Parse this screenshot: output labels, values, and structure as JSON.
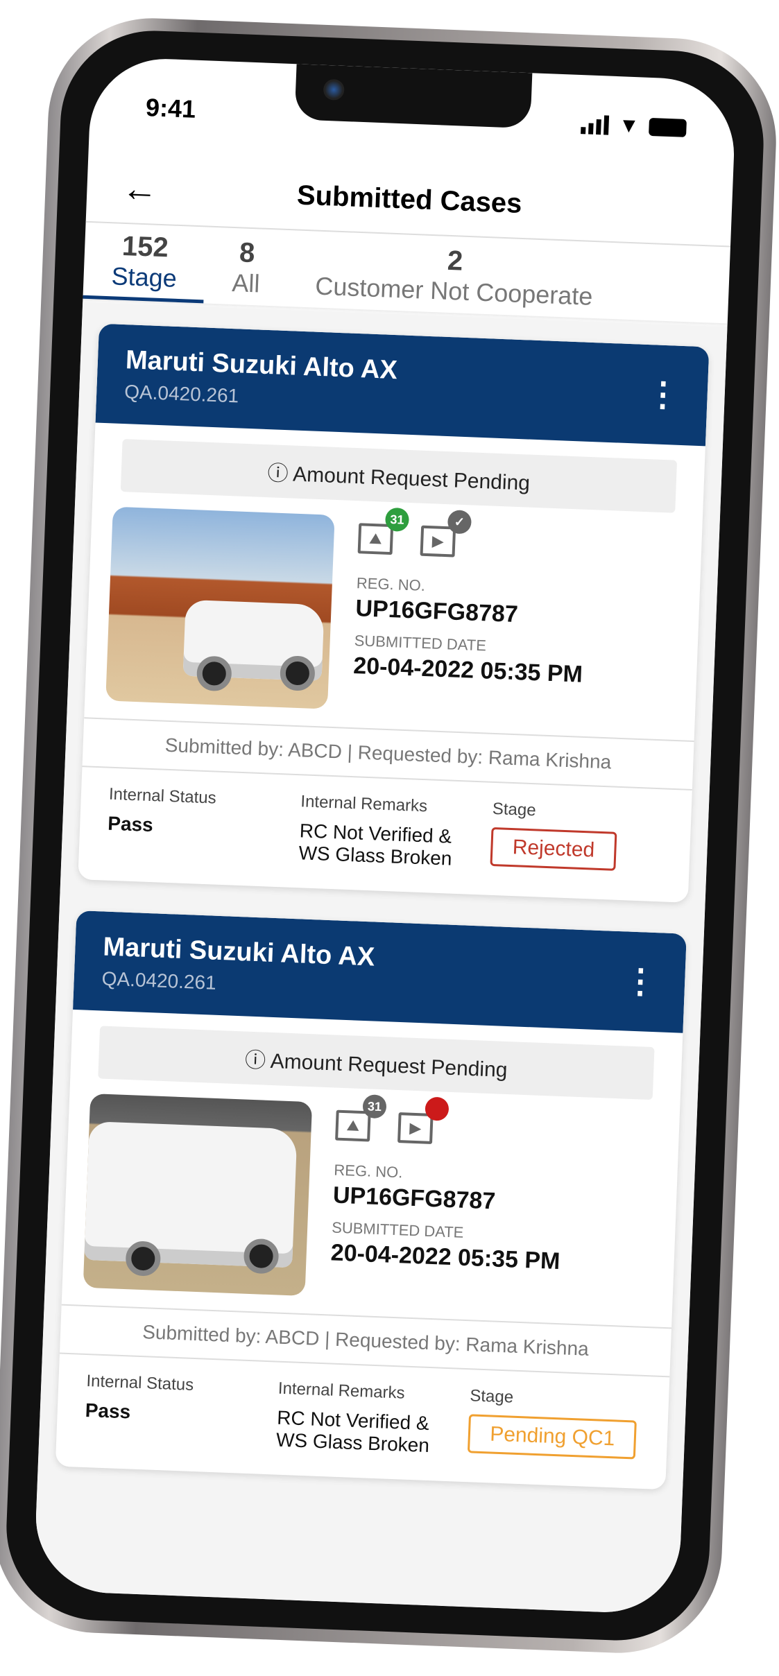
{
  "status_bar": {
    "time": "9:41"
  },
  "header": {
    "title": "Submitted Cases",
    "back_icon": "arrow-left-icon"
  },
  "tabs": [
    {
      "count": "152",
      "label": "Stage",
      "active": true
    },
    {
      "count": "8",
      "label": "All"
    },
    {
      "count": "2",
      "label": "Customer Not Cooperate"
    }
  ],
  "colors": {
    "brand": "#0b3a72",
    "rejected": "#c0392b",
    "pending_qc": "#f0a030",
    "photo_badge_green": "#2e9e3e",
    "video_badge_red": "#cc1a1a"
  },
  "cards": [
    {
      "name": "Maruti Suzuki Alto AX",
      "id": "QA.0420.261",
      "notice": "Amount Request Pending",
      "photo_count": "31",
      "reg_label": "REG. NO.",
      "reg_no": "UP16GFG8787",
      "date_label": "SUBMITTED DATE",
      "date": "20-04-2022 05:35 PM",
      "submitted_requested": "Submitted by: ABCD | Requested by: Rama Krishna",
      "status_label": "Internal Status",
      "status": "Pass",
      "remarks_label": "Internal Remarks",
      "remarks": "RC Not Verified & WS Glass Broken",
      "stage_label": "Stage",
      "stage": "Rejected"
    },
    {
      "name": "Maruti Suzuki Alto AX",
      "id": "QA.0420.261",
      "notice": "Amount Request Pending",
      "photo_count": "31",
      "reg_label": "REG. NO.",
      "reg_no": "UP16GFG8787",
      "date_label": "SUBMITTED DATE",
      "date": "20-04-2022 05:35 PM",
      "submitted_requested": "Submitted by: ABCD | Requested by: Rama Krishna",
      "status_label": "Internal Status",
      "status": "Pass",
      "remarks_label": "Internal Remarks",
      "remarks": "RC Not Verified & WS Glass Broken",
      "stage_label": "Stage",
      "stage": "Pending QC1"
    }
  ]
}
